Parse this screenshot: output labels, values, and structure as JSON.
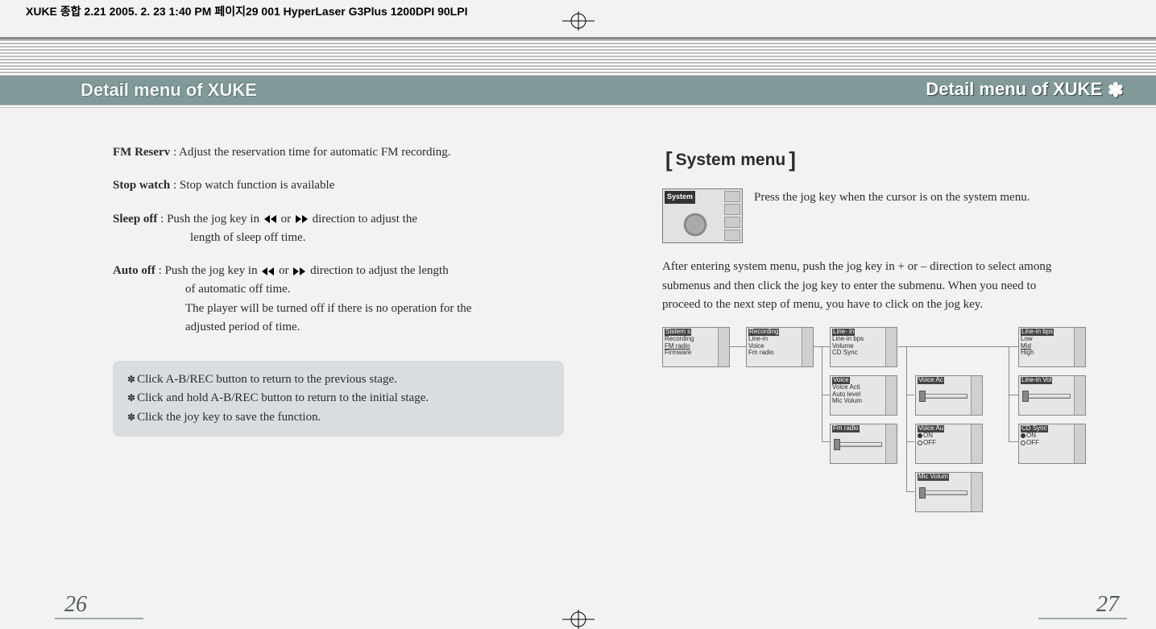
{
  "printer_meta": "XUKE 종합 2.21   2005. 2. 23 1:40 PM   페이지29    001 HyperLaser G3Plus 1200DPI 90LPI",
  "title_left": "Detail menu of XUKE",
  "title_right": "Detail menu of XUKE",
  "left_page": {
    "items": [
      {
        "label": "FM Reserv",
        "text": " : Adjust the reservation time for automatic FM recording."
      },
      {
        "label": "Stop watch",
        "text": " : Stop watch function is available"
      },
      {
        "label": "Sleep off",
        "text_a": "  : Push the jog key in  ",
        "text_b": " or  ",
        "text_c": "  direction to adjust the",
        "cont1": "length of sleep off time."
      },
      {
        "label": "Auto off",
        "text_a": "  : Push the jog key in  ",
        "text_b": " or  ",
        "text_c": " direction to adjust the length",
        "cont1": "of automatic off time.",
        "cont2": "The player will be turned off if there is no operation for the",
        "cont3": "adjusted period of time."
      }
    ],
    "notes": [
      "Click A-B/REC button to return to the previous stage.",
      "Click and hold A-B/REC button to return to the initial stage.",
      "Click the joy key to save the function."
    ],
    "page_number": "26"
  },
  "right_page": {
    "section_heading": "System menu",
    "system_lcd_label": "System",
    "intro_text": "Press the jog key when the cursor is on the system menu.",
    "para": "After entering system menu, push the jog key in + or – direction to select among submenus and then click the jog key to enter the submenu. When you need to proceed to the next step of menu, you have to click on the jog key.",
    "mini_screens": {
      "root": {
        "line1": "Ststem s",
        "line2": "Recording",
        "line3": "FM radio",
        "line4": "Firmware"
      },
      "recording": {
        "line1": "Recording",
        "line2": "Line-in",
        "line3": "Voice",
        "line4": "Fm radio"
      },
      "linein": {
        "line1": "Line- in",
        "line2": "Line-in bps",
        "line3": "Volume",
        "line4": "CD Sync"
      },
      "voice": {
        "line1": "Voice",
        "line2": "Voice Acti",
        "line3": "Auto level",
        "line4": "Mic Volum"
      },
      "fmradio": {
        "line1": "Fm radio"
      },
      "voiceac": {
        "line1": "Voice Ac"
      },
      "voiceau": {
        "line1": "Voice Au",
        "on": "ON",
        "off": "OFF"
      },
      "micvol": {
        "line1": "Mic Volum"
      },
      "lineinbps": {
        "line1": "Line-in bps",
        "line2": "Low",
        "line3": "Mid",
        "line4": "High"
      },
      "lineinvol": {
        "line1": "Line-in Vol"
      },
      "cdsync": {
        "line1": "CD Sync",
        "on": "ON",
        "off": "OFF"
      }
    },
    "page_number": "27"
  }
}
